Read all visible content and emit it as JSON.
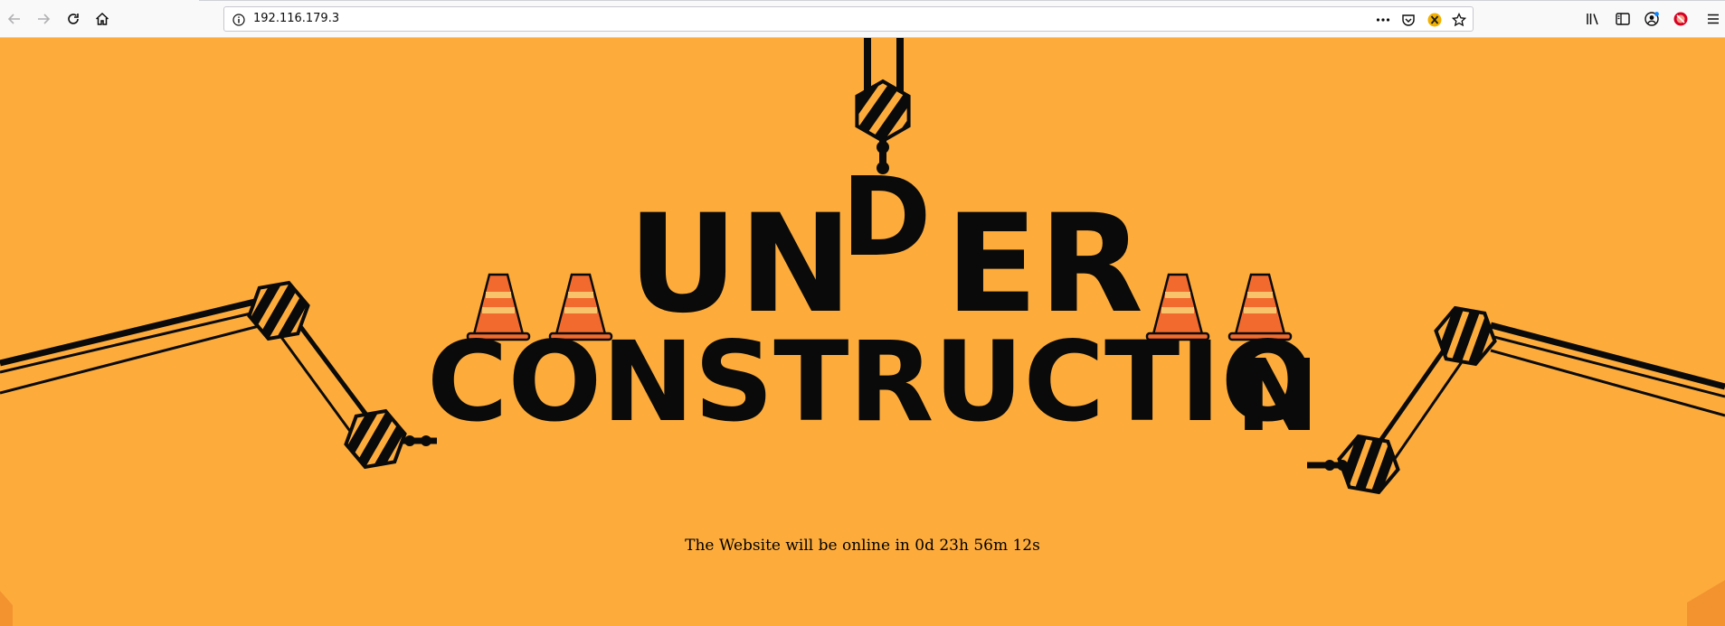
{
  "browser": {
    "url": "192.116.179.3",
    "icons": [
      "back-icon",
      "forward-icon",
      "reload-icon",
      "home-icon",
      "info-icon",
      "more-icon",
      "pocket-icon",
      "extension-icon",
      "bookmark-star-icon",
      "library-icon",
      "sidebar-icon",
      "account-icon",
      "blocker-icon",
      "menu-icon"
    ]
  },
  "page": {
    "headline_part1": "UN",
    "headline_dropped_letter": "D",
    "headline_part2": "ER",
    "headline_line2": "CONSTRUCTIO",
    "headline_line2_last": "N",
    "countdown_text": "The Website will be online in 0d 23h 56m 12s",
    "colors": {
      "background": "#fdac3c",
      "ink": "#0a0a0a",
      "cone_orange": "#f26a2e",
      "cone_stripe": "#f9c36b"
    }
  }
}
